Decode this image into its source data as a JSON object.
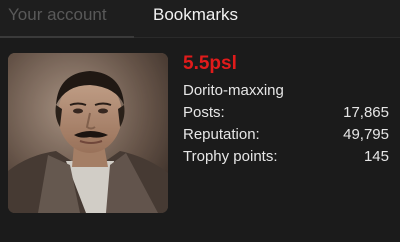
{
  "tabs": {
    "account_label": "Your account",
    "bookmarks_label": "Bookmarks"
  },
  "profile": {
    "username": "5.5psl",
    "username_color": "#e01b1b",
    "user_title": "Dorito-maxxing",
    "stats": [
      {
        "label": "Posts:",
        "value": "17,865"
      },
      {
        "label": "Reputation:",
        "value": "49,795"
      },
      {
        "label": "Trophy points:",
        "value": "145"
      }
    ]
  }
}
